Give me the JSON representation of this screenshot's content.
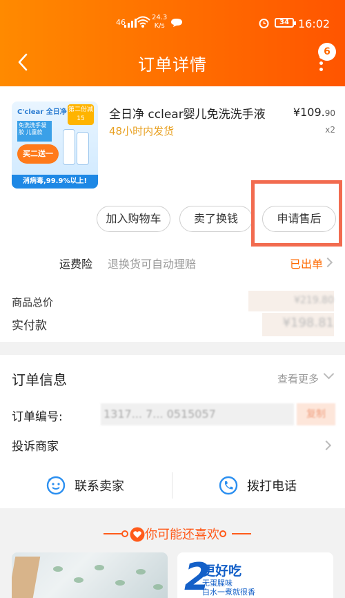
{
  "status_bar": {
    "signal": "46",
    "net_speed_value": "24.3",
    "net_speed_unit": "K/s",
    "battery": "34",
    "time": "16:02"
  },
  "header": {
    "title": "订单详情",
    "badge_count": "6"
  },
  "product": {
    "name": "全日净 cclear婴儿免洗洗手液",
    "shipping": "48小时内发货",
    "price_main": "¥109.",
    "price_cents": "90",
    "quantity": "x2",
    "thumb": {
      "brand": "C'clear 全日净",
      "corner": "第二份减15",
      "blue_box": "免洗洗手凝胶 儿童款",
      "promo": "买二送一",
      "strip": "消病毒,99.9%以上!"
    }
  },
  "actions": {
    "add_to_cart": "加入购物车",
    "resell": "卖了换钱",
    "after_sales": "申请售后"
  },
  "insurance": {
    "label": "运费险",
    "description": "退换货可自动理赔",
    "status": "已出单"
  },
  "summary": {
    "total_label": "商品总价",
    "total_value": "¥219.80",
    "paid_label": "实付款",
    "paid_value": "¥198.81"
  },
  "order_info": {
    "title": "订单信息",
    "more": "查看更多",
    "order_no_label": "订单编号:",
    "order_no_value": "1317... 7... 0515057",
    "copy": "复制",
    "complain": "投诉商家",
    "contact_seller": "联系卖家",
    "call_phone": "拨打电话"
  },
  "recommend": {
    "title": "你可能还喜欢",
    "item2_big": "2",
    "item2_title": "更好吃",
    "item2_line1": "无蛋腥味",
    "item2_line2": "白水一煮就很香"
  },
  "colors": {
    "accent": "#ff6a00",
    "shipping": "#e8a020",
    "highlight_box": "#f26b4f"
  }
}
